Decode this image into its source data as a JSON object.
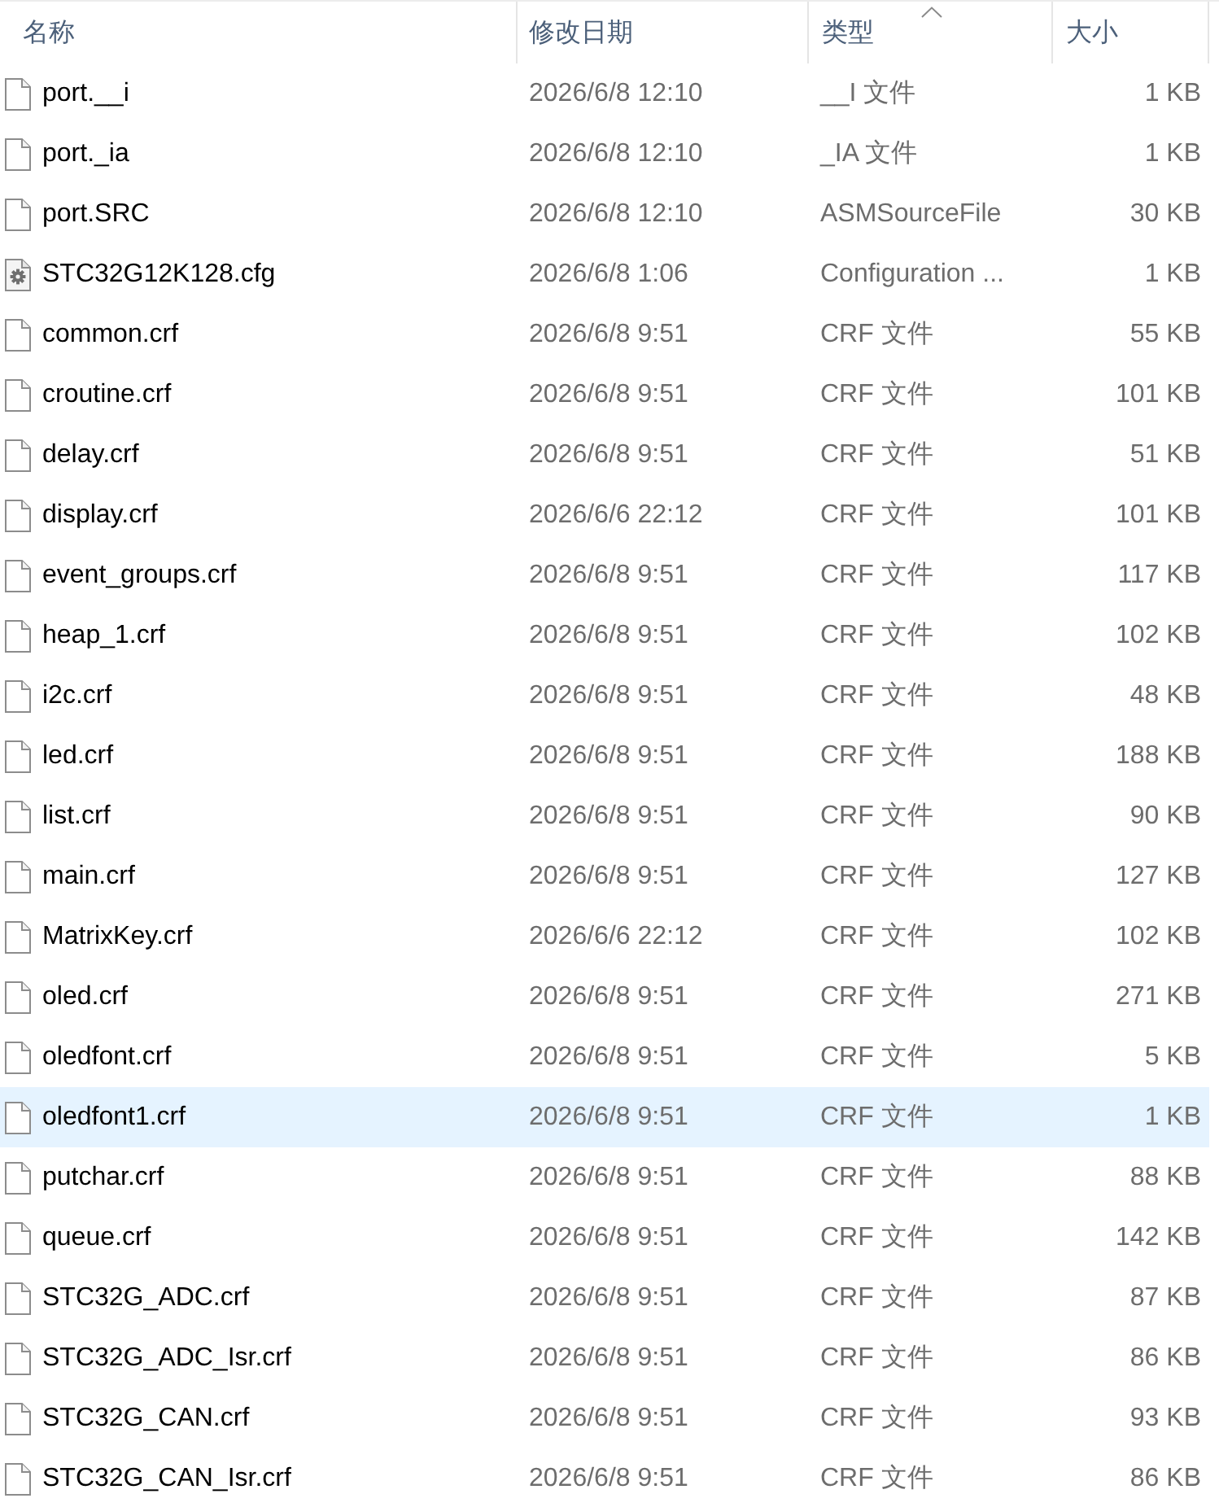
{
  "columns": [
    {
      "label": "名称",
      "sorted": false
    },
    {
      "label": "修改日期",
      "sorted": false
    },
    {
      "label": "类型",
      "sorted": true
    },
    {
      "label": "大小",
      "sorted": false
    }
  ],
  "rows": [
    {
      "kind": "file",
      "name": "port.__i",
      "modified": "2026/6/8 12:10",
      "type": "__I 文件",
      "size": "1 KB",
      "selected": false
    },
    {
      "kind": "file",
      "name": "port._ia",
      "modified": "2026/6/8 12:10",
      "type": "_IA 文件",
      "size": "1 KB",
      "selected": false
    },
    {
      "kind": "file",
      "name": "port.SRC",
      "modified": "2026/6/8 12:10",
      "type": "ASMSourceFile",
      "size": "30 KB",
      "selected": false
    },
    {
      "kind": "config",
      "name": "STC32G12K128.cfg",
      "modified": "2026/6/8 1:06",
      "type": "Configuration ...",
      "size": "1 KB",
      "selected": false
    },
    {
      "kind": "file",
      "name": "common.crf",
      "modified": "2026/6/8 9:51",
      "type": "CRF 文件",
      "size": "55 KB",
      "selected": false
    },
    {
      "kind": "file",
      "name": "croutine.crf",
      "modified": "2026/6/8 9:51",
      "type": "CRF 文件",
      "size": "101 KB",
      "selected": false
    },
    {
      "kind": "file",
      "name": "delay.crf",
      "modified": "2026/6/8 9:51",
      "type": "CRF 文件",
      "size": "51 KB",
      "selected": false
    },
    {
      "kind": "file",
      "name": "display.crf",
      "modified": "2026/6/6 22:12",
      "type": "CRF 文件",
      "size": "101 KB",
      "selected": false
    },
    {
      "kind": "file",
      "name": "event_groups.crf",
      "modified": "2026/6/8 9:51",
      "type": "CRF 文件",
      "size": "117 KB",
      "selected": false
    },
    {
      "kind": "file",
      "name": "heap_1.crf",
      "modified": "2026/6/8 9:51",
      "type": "CRF 文件",
      "size": "102 KB",
      "selected": false
    },
    {
      "kind": "file",
      "name": "i2c.crf",
      "modified": "2026/6/8 9:51",
      "type": "CRF 文件",
      "size": "48 KB",
      "selected": false
    },
    {
      "kind": "file",
      "name": "led.crf",
      "modified": "2026/6/8 9:51",
      "type": "CRF 文件",
      "size": "188 KB",
      "selected": false
    },
    {
      "kind": "file",
      "name": "list.crf",
      "modified": "2026/6/8 9:51",
      "type": "CRF 文件",
      "size": "90 KB",
      "selected": false
    },
    {
      "kind": "file",
      "name": "main.crf",
      "modified": "2026/6/8 9:51",
      "type": "CRF 文件",
      "size": "127 KB",
      "selected": false
    },
    {
      "kind": "file",
      "name": "MatrixKey.crf",
      "modified": "2026/6/6 22:12",
      "type": "CRF 文件",
      "size": "102 KB",
      "selected": false
    },
    {
      "kind": "file",
      "name": "oled.crf",
      "modified": "2026/6/8 9:51",
      "type": "CRF 文件",
      "size": "271 KB",
      "selected": false
    },
    {
      "kind": "file",
      "name": "oledfont.crf",
      "modified": "2026/6/8 9:51",
      "type": "CRF 文件",
      "size": "5 KB",
      "selected": false
    },
    {
      "kind": "file",
      "name": "oledfont1.crf",
      "modified": "2026/6/8 9:51",
      "type": "CRF 文件",
      "size": "1 KB",
      "selected": true
    },
    {
      "kind": "file",
      "name": "putchar.crf",
      "modified": "2026/6/8 9:51",
      "type": "CRF 文件",
      "size": "88 KB",
      "selected": false
    },
    {
      "kind": "file",
      "name": "queue.crf",
      "modified": "2026/6/8 9:51",
      "type": "CRF 文件",
      "size": "142 KB",
      "selected": false
    },
    {
      "kind": "file",
      "name": "STC32G_ADC.crf",
      "modified": "2026/6/8 9:51",
      "type": "CRF 文件",
      "size": "87 KB",
      "selected": false
    },
    {
      "kind": "file",
      "name": "STC32G_ADC_Isr.crf",
      "modified": "2026/6/8 9:51",
      "type": "CRF 文件",
      "size": "86 KB",
      "selected": false
    },
    {
      "kind": "file",
      "name": "STC32G_CAN.crf",
      "modified": "2026/6/8 9:51",
      "type": "CRF 文件",
      "size": "93 KB",
      "selected": false
    },
    {
      "kind": "file",
      "name": "STC32G_CAN_Isr.crf",
      "modified": "2026/6/8 9:51",
      "type": "CRF 文件",
      "size": "86 KB",
      "selected": false
    }
  ]
}
